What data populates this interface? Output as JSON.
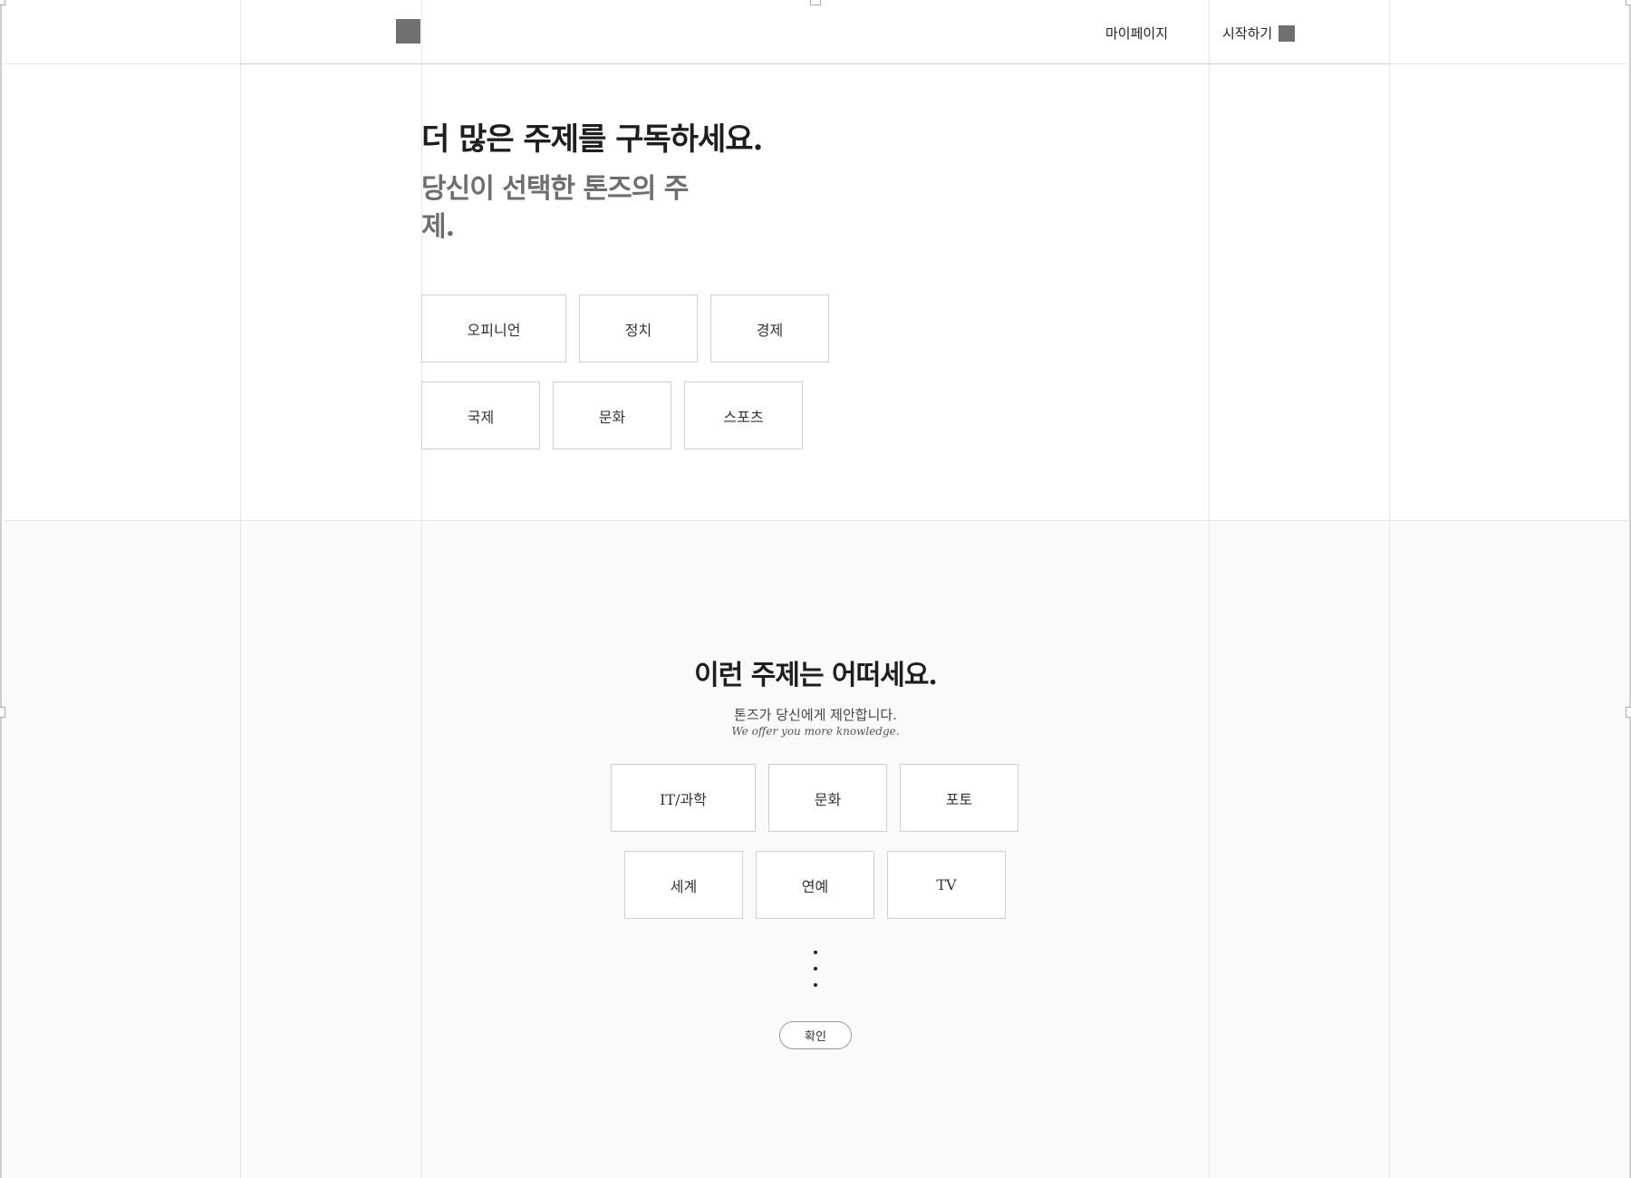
{
  "nav": {
    "mypage_label": "마이페이지",
    "start_label": "시작하기"
  },
  "subscribe": {
    "heading": "더 많은 주제를 구독하세요.",
    "subheading": "당신이 선택한 톤즈의 주제.",
    "topics": [
      "오피니언",
      "정치",
      "경제",
      "국제",
      "문화",
      "스포츠"
    ]
  },
  "suggest": {
    "heading": "이런 주제는 어떠세요.",
    "subtitle": "톤즈가 당신에게 제안합니다.",
    "subtitle_en": "We offer you more knowledge.",
    "topics": [
      "IT/과학",
      "문화",
      "포토",
      "세계",
      "연예",
      "TV"
    ],
    "confirm_label": "확인"
  },
  "colors": {
    "placeholder_square": "#707070",
    "section_bg": "#fafafa",
    "tile_border": "#cfcfcf"
  }
}
